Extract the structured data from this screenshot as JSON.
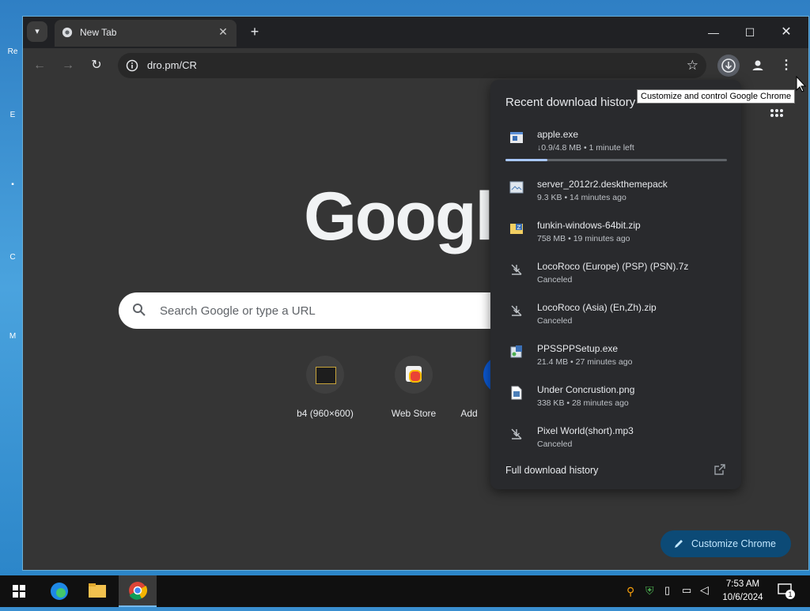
{
  "window": {
    "tab_title": "New Tab",
    "url": "dro.pm/CR"
  },
  "icons": {
    "tab_search": "chevron-down-icon",
    "new_tab": "plus-icon",
    "minimize": "minimize-icon",
    "maximize": "maximize-icon",
    "close": "close-icon",
    "back": "back-arrow-icon",
    "forward": "forward-arrow-icon",
    "reload": "reload-icon",
    "site_info": "info-icon",
    "bookmark": "star-icon",
    "downloads": "download-icon",
    "profile": "person-icon",
    "menu": "kebab-menu-icon"
  },
  "ntp": {
    "logo": "Google",
    "search_placeholder": "Search Google or type a URL",
    "shortcuts": [
      {
        "label": "b4 (960×600)"
      },
      {
        "label": "Web Store"
      },
      {
        "label": "Add"
      }
    ],
    "customize_label": "Customize Chrome"
  },
  "downloads": {
    "heading": "Recent download history",
    "items": [
      {
        "name": "apple.exe",
        "status": "↓0.9/4.8 MB • 1 minute left",
        "icon": "exe-file-icon",
        "progress": 0.19
      },
      {
        "name": "server_2012r2.deskthemepack",
        "status": "9.3 KB • 14 minutes ago",
        "icon": "theme-file-icon"
      },
      {
        "name": "funkin-windows-64bit.zip",
        "status": "758 MB • 19 minutes ago",
        "icon": "zip-folder-icon"
      },
      {
        "name": "LocoRoco (Europe) (PSP) (PSN).7z",
        "status": "Canceled",
        "icon": "canceled-download-icon"
      },
      {
        "name": "LocoRoco (Asia) (En,Zh).zip",
        "status": "Canceled",
        "icon": "canceled-download-icon"
      },
      {
        "name": "PPSSPPSetup.exe",
        "status": "21.4 MB • 27 minutes ago",
        "icon": "installer-icon"
      },
      {
        "name": "Under Concrustion.png",
        "status": "338 KB • 28 minutes ago",
        "icon": "image-file-icon"
      },
      {
        "name": "Pixel World(short).mp3",
        "status": "Canceled",
        "icon": "canceled-download-icon"
      }
    ],
    "full_history": "Full download history"
  },
  "tooltip": "Customize and control Google Chrome",
  "taskbar": {
    "time": "7:53 AM",
    "date": "10/6/2024",
    "notification_count": "1"
  },
  "colors": {
    "accent": "#a8c7fa",
    "panel_bg": "#292a2d",
    "page_bg": "#353535",
    "customize_bg": "#0c4a76"
  }
}
